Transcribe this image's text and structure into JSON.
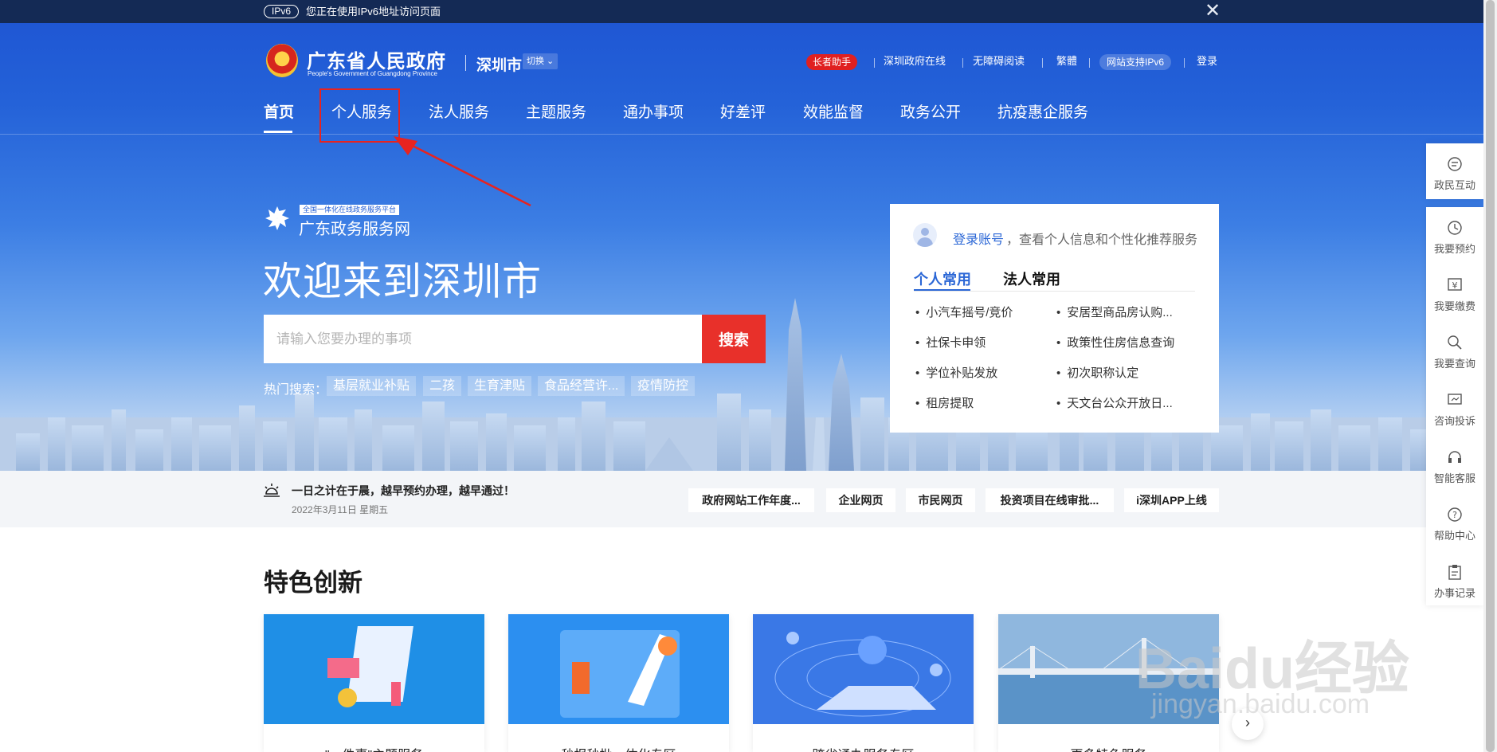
{
  "topbar": {
    "ipv6_badge": "IPv6",
    "notice": "您正在使用IPv6地址访问页面",
    "close": "✕"
  },
  "header": {
    "logo_title": "广东省人民政府",
    "logo_subtitle": "People's Government of Guangdong Province",
    "city": "深圳市",
    "switch_label": "切换",
    "elder_helper": "长者助手",
    "links": [
      "深圳政府在线",
      "无障碍阅读",
      "繁體"
    ],
    "ipv6_support": "网站支持IPv6",
    "login": "登录"
  },
  "nav": {
    "items": [
      "首页",
      "个人服务",
      "法人服务",
      "主题服务",
      "通办事项",
      "好差评",
      "效能监督",
      "政务公开",
      "抗疫惠企服务"
    ]
  },
  "hero": {
    "platform_badge": "全国一体化在线政务服务平台",
    "platform_name": "广东政务服务网",
    "welcome": "欢迎来到深圳市",
    "search_placeholder": "请输入您要办理的事项",
    "search_button": "搜索",
    "hot_label": "热门搜索：",
    "hot_tags": [
      "基层就业补贴",
      "二孩",
      "生育津贴",
      "食品经营许...",
      "疫情防控"
    ]
  },
  "card": {
    "login_link": "登录账号",
    "login_desc": "，查看个人信息和个性化推荐服务",
    "tabs": [
      "个人常用",
      "法人常用"
    ],
    "services": [
      "小汽车摇号/竞价",
      "安居型商品房认购...",
      "社保卡申领",
      "政策性住房信息查询",
      "学位补贴发放",
      "初次职称认定",
      "租房提取",
      "天文台公众开放日..."
    ]
  },
  "strip": {
    "slogan": "一日之计在于晨，越早预约办理，越早通过！",
    "date": "2022年3月11日 星期五",
    "links": [
      "政府网站工作年度...",
      "企业网页",
      "市民网页",
      "投资项目在线审批...",
      "i深圳APP上线"
    ]
  },
  "featured": {
    "title": "特色创新",
    "captions": [
      "\"一件事\"主题服务",
      "秒报秒批一体化专区",
      "跨省通办服务专区",
      "更多特色服务"
    ]
  },
  "float_toolbar": {
    "items": [
      "政民互动",
      "我要预约",
      "我要缴费",
      "我要查询",
      "咨询投诉",
      "智能客服",
      "帮助中心",
      "办事记录"
    ]
  },
  "watermark": {
    "text": "Baidu经验",
    "url": "jingyan.baidu.com"
  },
  "colors": {
    "primary_blue": "#2462d8",
    "accent_red": "#e8302a",
    "link_blue": "#2b67d6"
  }
}
